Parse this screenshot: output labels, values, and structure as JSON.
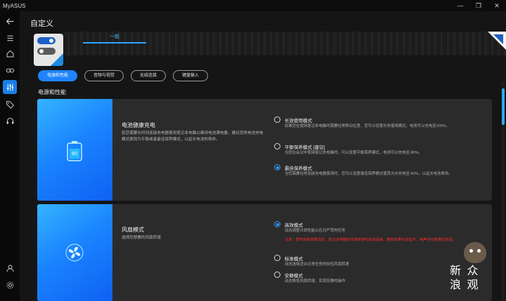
{
  "app": {
    "title": "MyASUS"
  },
  "window_controls": {
    "minimize": "—",
    "maximize": "❐",
    "close": "✕"
  },
  "sidebar": {
    "items": [
      {
        "name": "back",
        "icon": "back-arrow-icon"
      },
      {
        "name": "menu",
        "icon": "hamburger-menu-icon"
      },
      {
        "name": "home",
        "icon": "home-icon"
      },
      {
        "name": "link",
        "icon": "link-icon"
      },
      {
        "name": "customization",
        "icon": "sliders-icon",
        "active": true
      },
      {
        "name": "promotions",
        "icon": "tag-icon"
      },
      {
        "name": "support",
        "icon": "headset-icon"
      },
      {
        "name": "account",
        "icon": "user-icon"
      },
      {
        "name": "settings",
        "icon": "gear-icon"
      }
    ]
  },
  "page": {
    "title": "自定义"
  },
  "tabs": [
    {
      "label": "一般",
      "active": true
    }
  ],
  "chips": [
    {
      "label": "电源和性能",
      "active": true
    },
    {
      "label": "音频与视觉"
    },
    {
      "label": "无线连接"
    },
    {
      "label": "键盘输入"
    }
  ],
  "section": {
    "title": "电源和性能"
  },
  "battery": {
    "title": "电池健康充电",
    "description": "若您需要长时间连接充电器使用笔记本电脑以维持电池满电量，建议您将电池充电模式更改为平衡或者最佳保养模式，以延长电池的寿命。",
    "icon_value": "60",
    "options": [
      {
        "label": "长效使用模式",
        "description": "如果您在使用笔记本电脑时需要经常移动位置，您可以设置长效使用模式，电池可以充电至100%。",
        "selected": false
      },
      {
        "label": "平衡保养模式 [建议]",
        "description": "当您在会议中使用笔记本电脑时，可以设置平衡保养模式，电池可以充电至 80%。",
        "selected": false
      },
      {
        "label": "最佳保养模式",
        "description": "当您需要经常连接充电器使用时，您可以设置最佳保养模式使其允许充电至 60%，以延长电池寿命。",
        "selected": true
      }
    ]
  },
  "fan": {
    "title": "风扇模式",
    "description": "选择您想要的风扇转速",
    "options": [
      {
        "label": "高效模式",
        "description": "动态调整冷却性能以应对严苛的任务",
        "warning": "注意：若开启高效模式后，笔记本电脑的风扇转速可能会提高，散热效果也会提升，噪声也可能相应增加。",
        "selected": true
      },
      {
        "label": "标准模式",
        "description": "动态选择适合日常任务的较佳风扇转速",
        "selected": false
      },
      {
        "label": "安静模式",
        "description": "动态降低风扇转速，实现安静的操作",
        "selected": false
      }
    ]
  },
  "watermark": {
    "text_line1": "新 众",
    "text_line2": "浪 观"
  },
  "colors": {
    "accent": "#1f84ff",
    "background": "#151515",
    "card": "#2b2b2b",
    "warning": "#ff2a2a"
  }
}
